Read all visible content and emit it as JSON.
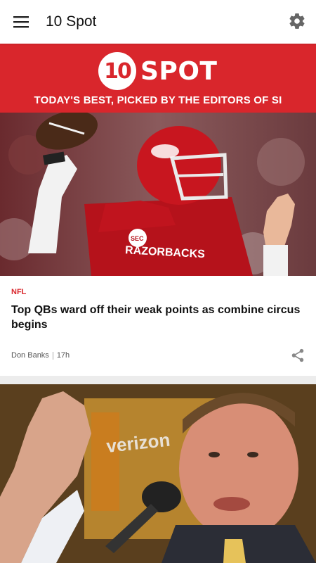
{
  "app_bar": {
    "title": "10 Spot",
    "menu_icon": "hamburger-menu-icon",
    "settings_icon": "gear-icon"
  },
  "banner": {
    "logo_number": "10",
    "logo_word": "SPOT",
    "tagline": "TODAY'S BEST, PICKED BY THE EDITORS OF SI",
    "color": "#d9262c"
  },
  "articles": [
    {
      "league": "NFL",
      "headline": "Top QBs ward off their weak points as combine circus begins",
      "author": "Don Banks",
      "age": "17h",
      "share_icon": "share-icon",
      "image_jersey_text": "RAZORBACKS",
      "image_helmet_text": "SEC"
    },
    {
      "image_logo_text": "verizon"
    }
  ]
}
